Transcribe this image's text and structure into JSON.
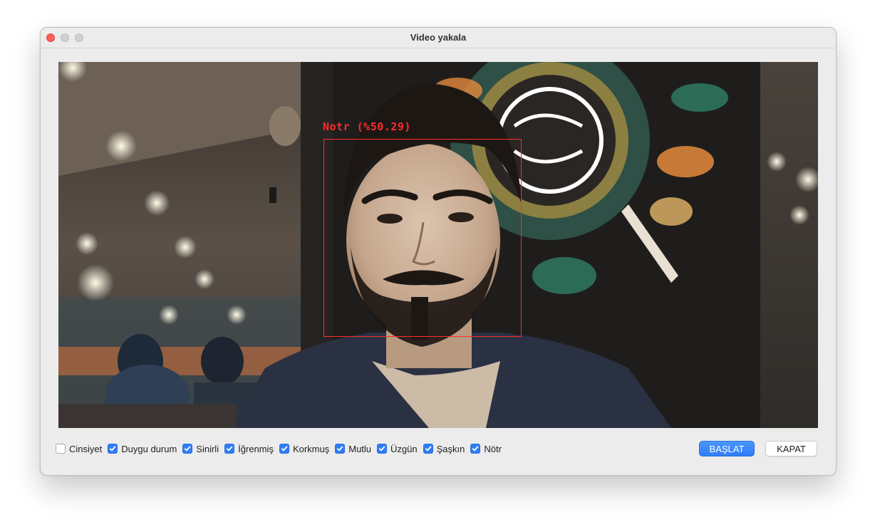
{
  "window": {
    "title": "Video yakala"
  },
  "video": {
    "overlay_label": "Notr (%50.29)",
    "overlay_color": "#ff2b2b"
  },
  "options": [
    {
      "label": "Cinsiyet",
      "checked": false
    },
    {
      "label": "Duygu durum",
      "checked": true
    },
    {
      "label": "Sinirli",
      "checked": true
    },
    {
      "label": "İğrenmiş",
      "checked": true
    },
    {
      "label": "Korkmuş",
      "checked": true
    },
    {
      "label": "Mutlu",
      "checked": true
    },
    {
      "label": "Üzgün",
      "checked": true
    },
    {
      "label": "Şaşkın",
      "checked": true
    },
    {
      "label": "Nötr",
      "checked": true
    }
  ],
  "buttons": {
    "start": "BAŞLAT",
    "close": "KAPAT"
  },
  "colors": {
    "accent": "#2f7df6",
    "close_dot": "#fe5f57"
  }
}
